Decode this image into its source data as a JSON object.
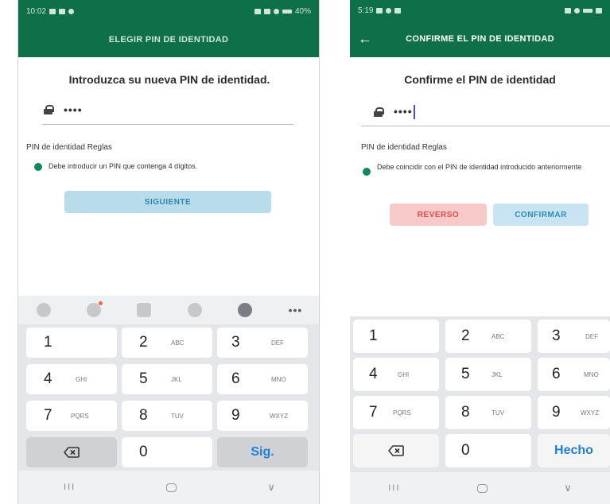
{
  "screen_a": {
    "status": {
      "time": "10:02",
      "battery": "40%"
    },
    "title": "ELEGIR PIN DE IDENTIDAD",
    "heading": "Introduzca su nueva PIN de identidad.",
    "pin_value": "••••",
    "rules_title": "PIN de identidad Reglas",
    "rule": "Debe introducir un PIN que contenga 4 dígitos.",
    "next_button": "SIGUIENTE",
    "toolbar_more": "•••",
    "keys": [
      {
        "digit": "1",
        "letters": ""
      },
      {
        "digit": "2",
        "letters": "ABC"
      },
      {
        "digit": "3",
        "letters": "DEF"
      },
      {
        "digit": "4",
        "letters": "GHI"
      },
      {
        "digit": "5",
        "letters": "JKL"
      },
      {
        "digit": "6",
        "letters": "MNO"
      },
      {
        "digit": "7",
        "letters": "PQRS"
      },
      {
        "digit": "8",
        "letters": "TUV"
      },
      {
        "digit": "9",
        "letters": "WXYZ"
      },
      {
        "digit": "0",
        "letters": ""
      }
    ],
    "action_key": "Sig."
  },
  "screen_b": {
    "status": {
      "time": "5:19"
    },
    "back_arrow": "←",
    "title": "CONFIRME EL PIN DE IDENTIDAD",
    "heading": "Confirme el PIN de identidad",
    "pin_value": "••••",
    "rules_title": "PIN de identidad Reglas",
    "rule": "Debe coincidir con el PIN de identidad introducido anteriormente",
    "back_button": "REVERSO",
    "confirm_button": "CONFIRMAR",
    "keys": [
      {
        "digit": "1",
        "letters": ""
      },
      {
        "digit": "2",
        "letters": "ABC"
      },
      {
        "digit": "3",
        "letters": "DEF"
      },
      {
        "digit": "4",
        "letters": "GHI"
      },
      {
        "digit": "5",
        "letters": "JKL"
      },
      {
        "digit": "6",
        "letters": "MNO"
      },
      {
        "digit": "7",
        "letters": "PQRS"
      },
      {
        "digit": "8",
        "letters": "TUV"
      },
      {
        "digit": "9",
        "letters": "WXYZ"
      },
      {
        "digit": "0",
        "letters": ""
      }
    ],
    "action_key": "Hecho"
  },
  "nav": {
    "recent": "III",
    "back": "∨"
  },
  "colors": {
    "brand_green": "#0e7048",
    "rule_dot": "#0e8a57",
    "link_blue": "#1f7fd6"
  }
}
